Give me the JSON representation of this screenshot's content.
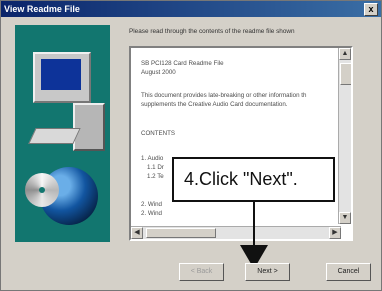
{
  "window": {
    "title": "View Readme File",
    "close_glyph": "x"
  },
  "panel": {
    "art": [
      "monitor-icon",
      "computer-tower-icon",
      "keyboard-icon",
      "cd-icon",
      "globe-icon"
    ]
  },
  "instruction": "Please read through the contents of the readme file shown",
  "readme": {
    "lines": [
      "SB PCI128 Card Readme File",
      "August 2000",
      "This document provides late-breaking or other information th",
      "supplements the Creative Audio Card documentation.",
      "CONTENTS",
      "1. Audio",
      "1.1 Dr",
      "1.2 Te",
      "2. Wind",
      "2. Wind"
    ]
  },
  "callout": {
    "text": "4.Click \"Next\"."
  },
  "buttons": {
    "back": "< Back",
    "next": "Next >",
    "cancel": "Cancel"
  },
  "scroll": {
    "up_glyph": "▲",
    "down_glyph": "▼",
    "left_glyph": "◀",
    "right_glyph": "▶"
  }
}
